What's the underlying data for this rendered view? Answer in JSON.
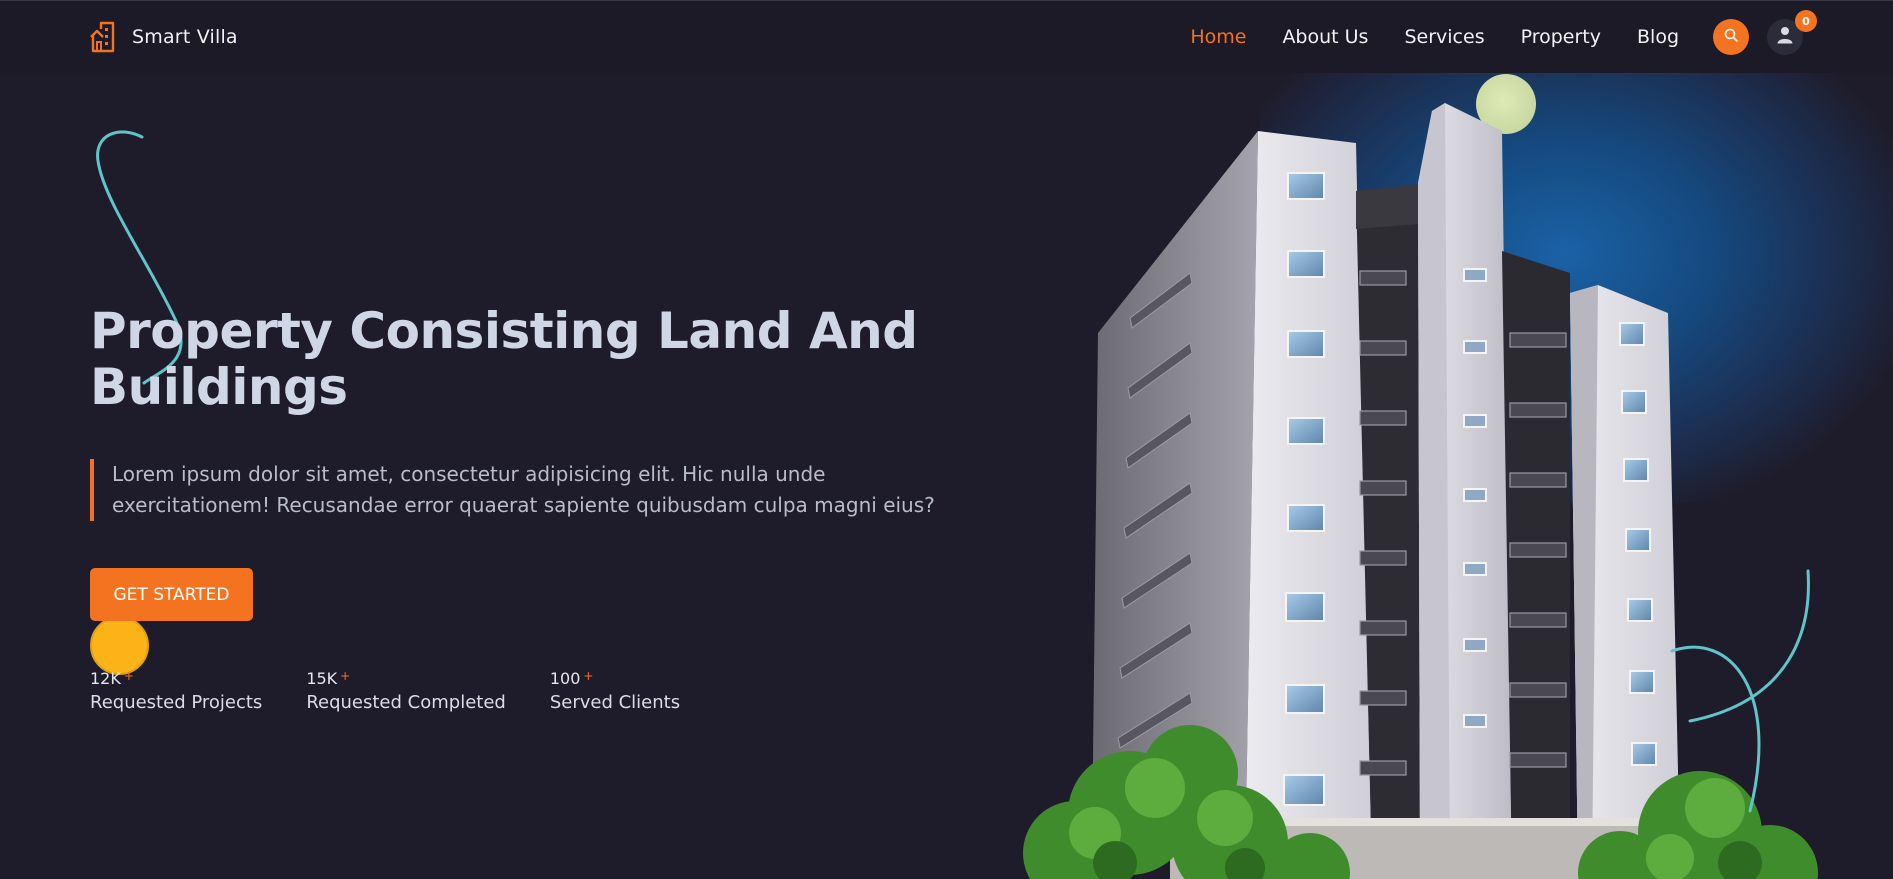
{
  "header": {
    "brand_name": "Smart Villa",
    "nav": [
      {
        "label": "Home",
        "active": true
      },
      {
        "label": "About Us",
        "active": false
      },
      {
        "label": "Services",
        "active": false
      },
      {
        "label": "Property",
        "active": false
      },
      {
        "label": "Blog",
        "active": false
      }
    ],
    "search_icon": "search-icon",
    "user_icon": "user-icon",
    "cart_count": "0"
  },
  "hero": {
    "title": "Property Consisting Land And Buildings",
    "description": "Lorem ipsum dolor sit amet, consectetur adipisicing elit. Hic nulla unde exercitationem! Recusandae error quaerat sapiente quibusdam culpa magni eius?",
    "cta_label": "GET STARTED",
    "stats": [
      {
        "value": "12K",
        "plus": "+",
        "label": "Requested Projects"
      },
      {
        "value": "15K",
        "plus": "+",
        "label": "Requested Completed"
      },
      {
        "value": "100",
        "plus": "+",
        "label": "Served Clients"
      }
    ]
  },
  "colors": {
    "accent": "#f47320",
    "background": "#1e1c2a",
    "glow": "#1a62a6",
    "squiggle": "#5fc5c9",
    "yellow": "#fbb317"
  }
}
